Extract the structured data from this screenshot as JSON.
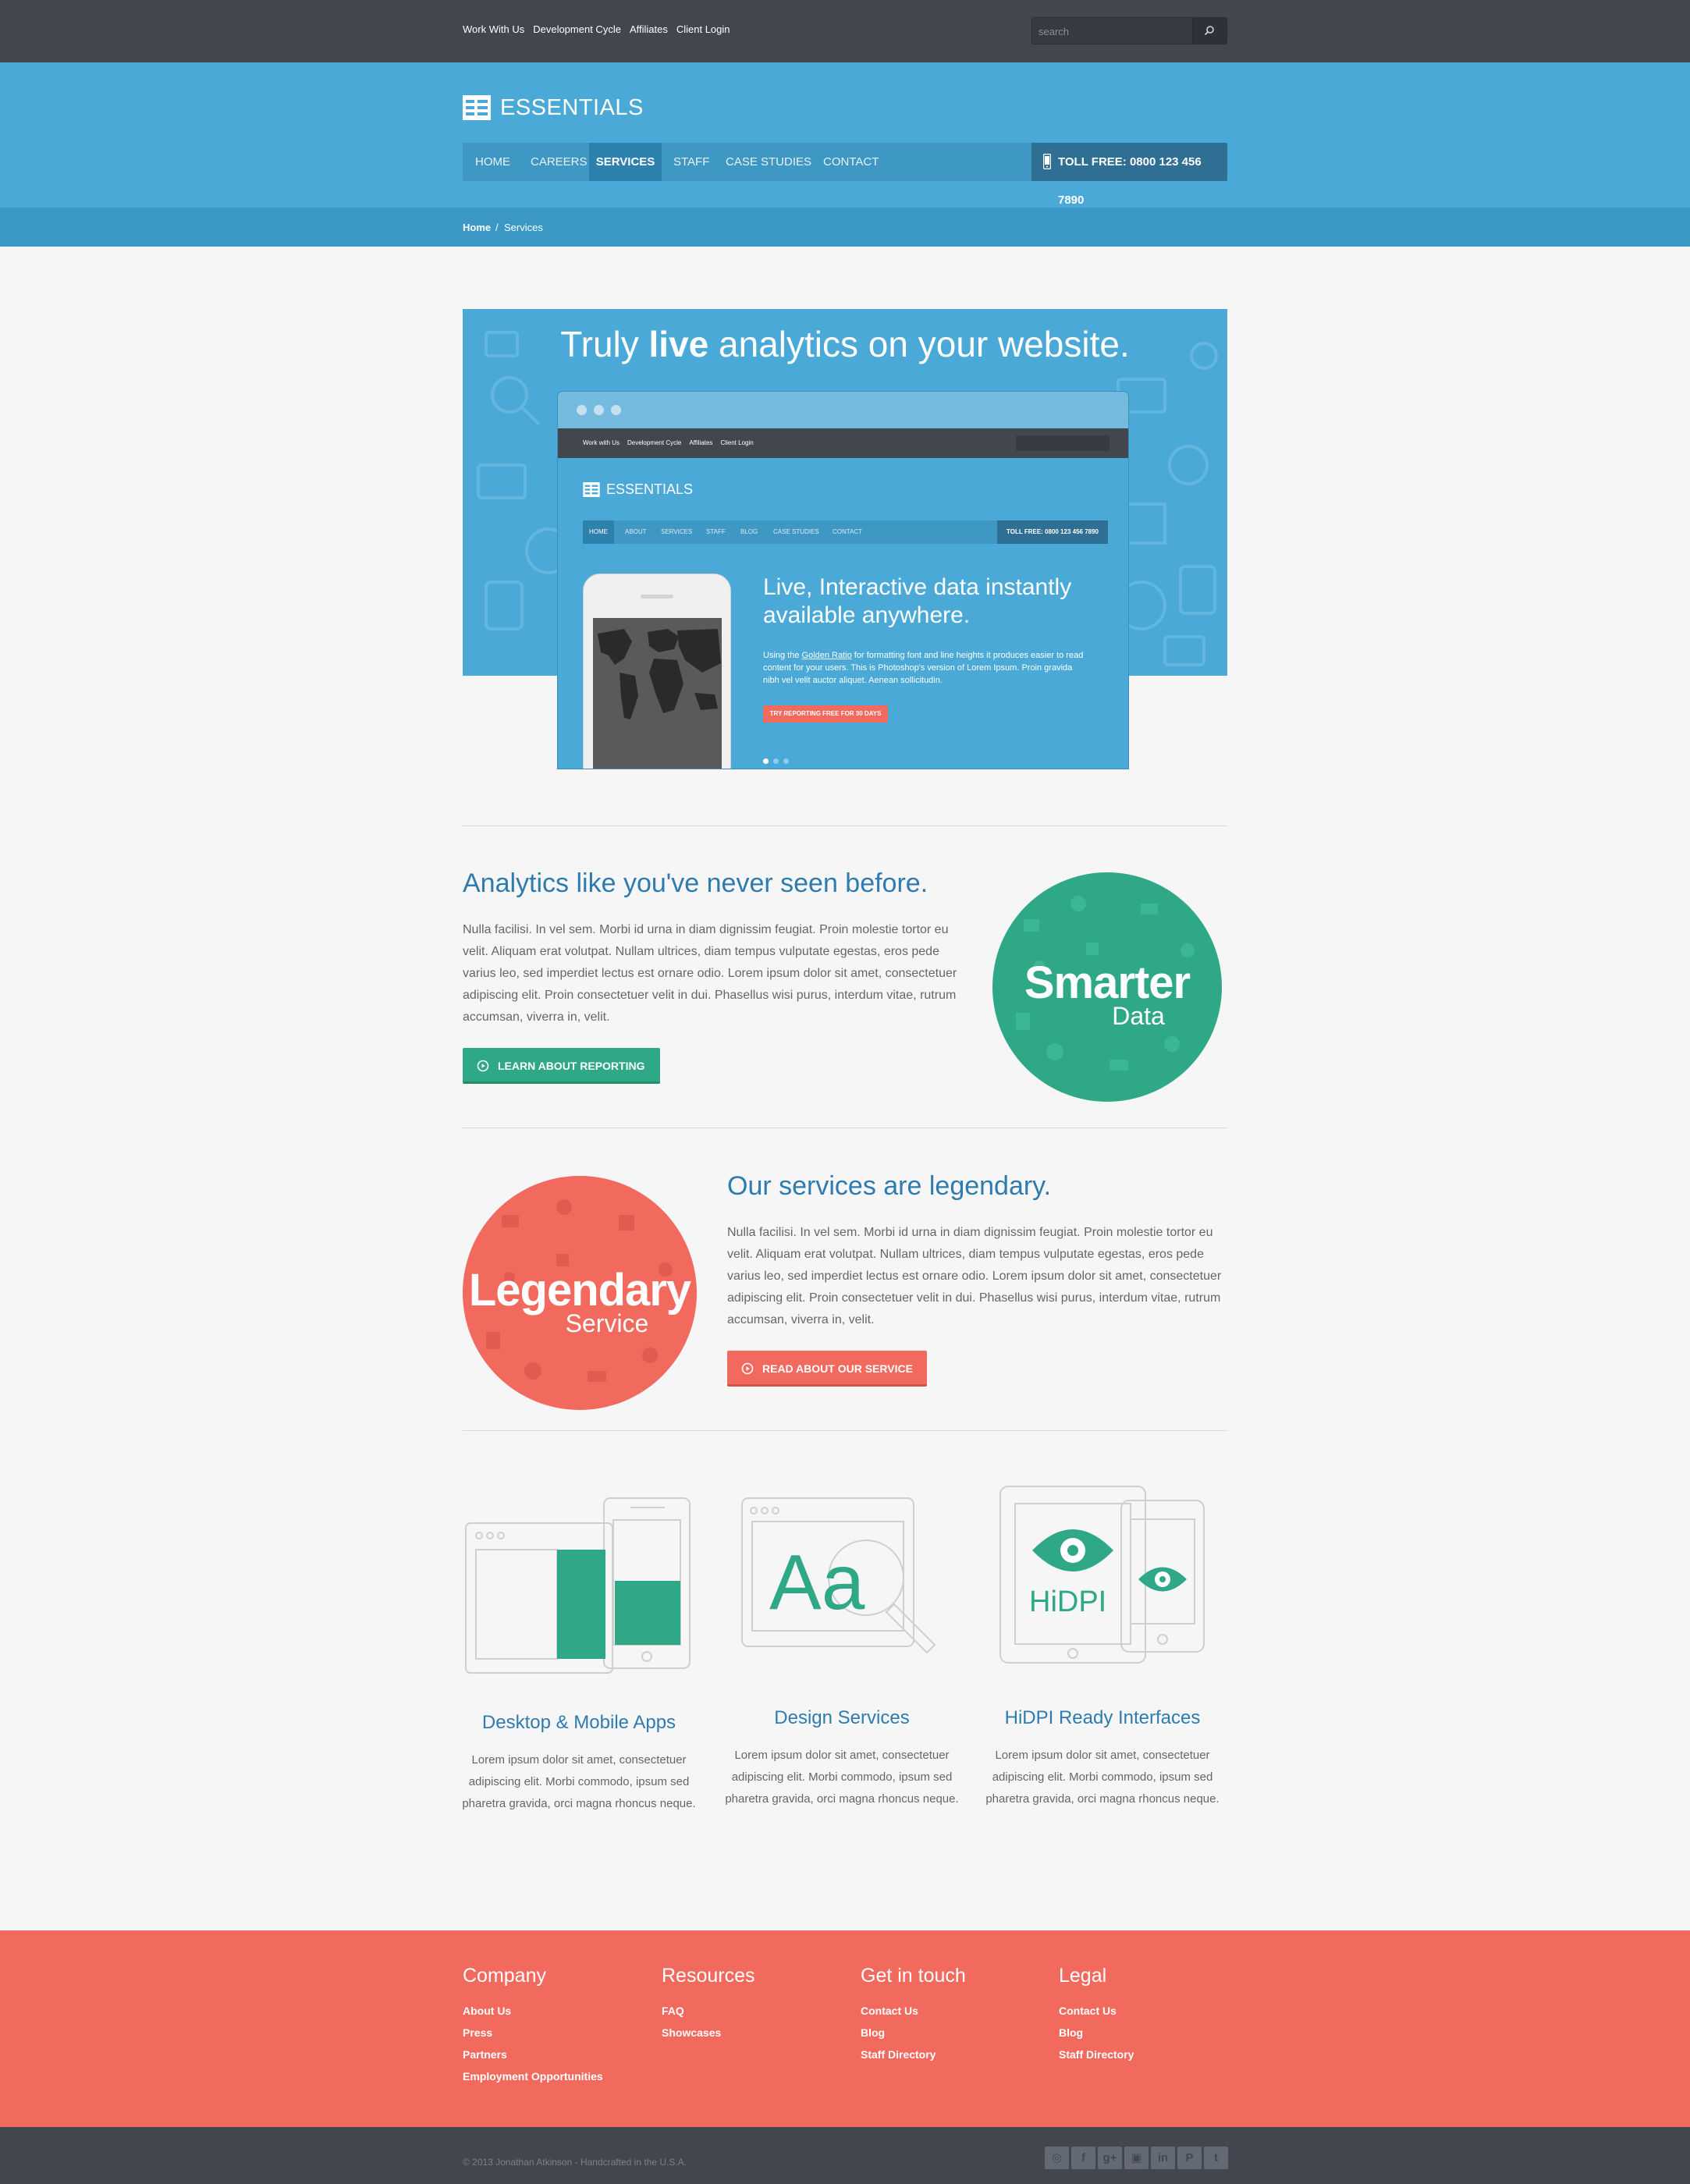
{
  "topbar": {
    "links": [
      "Work With Us",
      "Development Cycle",
      "Affiliates",
      "Client Login"
    ],
    "search_placeholder": "search"
  },
  "header": {
    "logo_text": "ESSENTIALS",
    "nav": [
      "HOME",
      "CAREERS",
      "SERVICES",
      "STAFF",
      "CASE STUDIES",
      "CONTACT"
    ],
    "active_nav": "SERVICES",
    "toll_free": "TOLL FREE: 0800 123 456 7890"
  },
  "breadcrumb": [
    "Home",
    "Services"
  ],
  "hero": {
    "title_pre": "Truly ",
    "title_bold": "live",
    "title_post": " analytics on your website.",
    "mockup": {
      "top_links": [
        "Work with Us",
        "Development Cycle",
        "Affiliates",
        "Client Login"
      ],
      "logo_text": "ESSENTIALS",
      "nav": [
        "HOME",
        "ABOUT",
        "SERVICES",
        "STAFF",
        "BLOG",
        "CASE STUDIES",
        "CONTACT"
      ],
      "toll_free": "TOLL FREE: 0800 123 456 7890",
      "headline": "Live, Interactive data instantly available anywhere.",
      "body_pre": "Using the ",
      "body_link": "Golden Ratio",
      "body_post": " for formatting font and line heights it produces easier to read content for your users. This is Photoshop's version  of Lorem Ipsum. Proin gravida nibh vel velit auctor aliquet. Aenean sollicitudin.",
      "cta": "TRY REPORTING FREE FOR 30 DAYS"
    }
  },
  "feature1": {
    "heading": "Analytics like you've never seen before.",
    "body": "Nulla facilisi. In vel sem. Morbi id urna in diam dignissim feugiat. Proin molestie tortor eu velit. Aliquam erat volutpat. Nullam ultrices, diam tempus vulputate egestas, eros pede varius leo, sed imperdiet lectus est ornare odio. Lorem ipsum dolor sit amet, consectetuer adipiscing elit. Proin consectetuer velit in dui. Phasellus wisi purus, interdum vitae, rutrum accumsan, viverra in, velit.",
    "button": "LEARN ABOUT REPORTING",
    "badge_big": "Smarter",
    "badge_small": "Data",
    "color": "#2fa887"
  },
  "feature2": {
    "heading": "Our services are legendary.",
    "body": "Nulla facilisi. In vel sem. Morbi id urna in diam dignissim feugiat. Proin molestie tortor eu velit. Aliquam erat volutpat. Nullam ultrices, diam tempus vulputate egestas, eros pede varius leo, sed imperdiet lectus est ornare odio. Lorem ipsum dolor sit amet, consectetuer adipiscing elit. Proin consectetuer velit in dui. Phasellus wisi purus, interdum vitae, rutrum accumsan, viverra in, velit.",
    "button": "READ ABOUT OUR SERVICE",
    "badge_big": "Legendary",
    "badge_small": "Service",
    "color": "#f26a5e"
  },
  "services": [
    {
      "title": "Desktop & Mobile Apps",
      "body": "Lorem ipsum dolor sit amet, consectetuer adipiscing elit. Morbi commodo, ipsum sed pharetra gravida, orci magna rhoncus neque.",
      "icon": "devices-icon"
    },
    {
      "title": "Design Services",
      "body": "Lorem ipsum dolor sit amet, consectetuer adipiscing elit. Morbi commodo, ipsum sed pharetra gravida, orci magna rhoncus neque.",
      "icon": "typography-magnifier-icon",
      "glyph": "Aa"
    },
    {
      "title": "HiDPI Ready Interfaces",
      "body": "Lorem ipsum dolor sit amet, consectetuer adipiscing elit. Morbi commodo, ipsum sed pharetra gravida, orci magna rhoncus neque.",
      "icon": "hidpi-eye-icon",
      "glyph": "HiDPI"
    }
  ],
  "footer": {
    "columns": [
      {
        "title": "Company",
        "links": [
          "About Us",
          "Press",
          "Partners",
          "Employment Opportunities"
        ]
      },
      {
        "title": "Resources",
        "links": [
          "FAQ",
          "Showcases"
        ]
      },
      {
        "title": "Get in touch",
        "links": [
          "Contact Us",
          "Blog",
          "Staff Directory"
        ]
      },
      {
        "title": "Legal",
        "links": [
          "Contact Us",
          "Blog",
          "Staff Directory"
        ]
      }
    ],
    "copyright": "© 2013 Jonathan Atkinson - Handcrafted in the U.S.A.",
    "social": [
      "dribbble",
      "facebook",
      "google-plus",
      "instagram",
      "linkedin",
      "pinterest",
      "twitter"
    ],
    "social_glyphs": [
      "◎",
      "f",
      "g+",
      "▣",
      "in",
      "P",
      "t"
    ]
  },
  "colors": {
    "blue": "#4aa9d6",
    "dark": "#41464f",
    "green": "#2fa887",
    "coral": "#f26a5e",
    "heading": "#2e7bb0"
  }
}
